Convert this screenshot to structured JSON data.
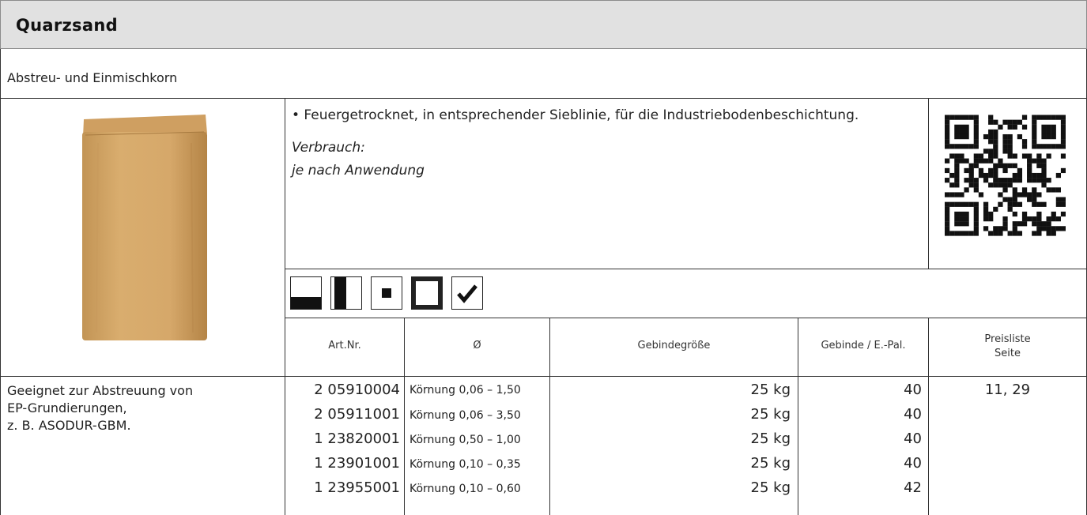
{
  "product": {
    "title": "Quarzsand",
    "subtitle": "Abstreu- und Einmischkorn",
    "bullet": "• Feuergetrocknet, in entsprechender Sieblinie, für die Industriebodenbeschichtung.",
    "consumption_label": "Verbrauch:",
    "consumption_value": "je nach Anwendung",
    "suitability": [
      "Geeignet zur Abstreuung von",
      "EP-Grundierungen,",
      "z. B. ASODUR-GBM."
    ]
  },
  "icons": [
    "floor-icon",
    "wall-icon",
    "interior-icon",
    "exterior-icon",
    "approved-check-icon"
  ],
  "table": {
    "headers": {
      "art": "Art.Nr.",
      "diameter": "Ø",
      "size": "Gebindegröße",
      "per_pallet": "Gebinde / E.-Pal.",
      "price_1": "Preisliste",
      "price_2": "Seite"
    },
    "rows": [
      {
        "art": "2 05910004",
        "grain": "Körnung 0,06 – 1,50",
        "size": "25 kg",
        "pallet": "40",
        "page": "11, 29"
      },
      {
        "art": "2 05911001",
        "grain": "Körnung 0,06 – 3,50",
        "size": "25 kg",
        "pallet": "40",
        "page": ""
      },
      {
        "art": "1 23820001",
        "grain": "Körnung 0,50 – 1,00",
        "size": "25 kg",
        "pallet": "40",
        "page": ""
      },
      {
        "art": "1 23901001",
        "grain": "Körnung 0,10 – 0,35",
        "size": "25 kg",
        "pallet": "40",
        "page": ""
      },
      {
        "art": "1 23955001",
        "grain": "Körnung 0,10 – 0,60",
        "size": "25 kg",
        "pallet": "42",
        "page": ""
      }
    ]
  }
}
